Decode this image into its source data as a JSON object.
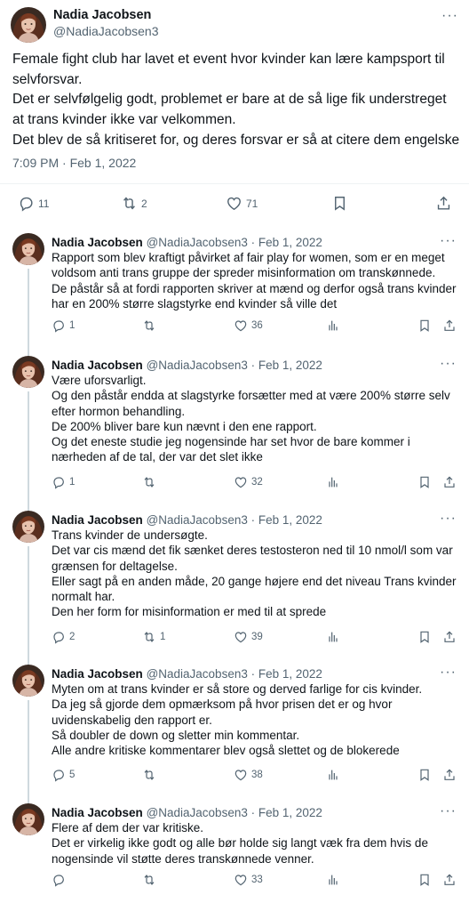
{
  "main": {
    "author_name": "Nadia Jacobsen",
    "author_handle": "@NadiaJacobsen3",
    "text": "Female fight club har lavet et event hvor kvinder kan lære kampsport til selvforsvar.\nDet er selvfølgelig godt, problemet er bare at de så lige fik understreget at trans kvinder ikke var velkommen.\nDet blev de så kritiseret for, og deres forsvar er så at citere dem engelske",
    "timestamp": "7:09 PM · Feb 1, 2022",
    "replies": "11",
    "retweets": "2",
    "likes": "71"
  },
  "replies": [
    {
      "name": "Nadia Jacobsen",
      "meta": "@NadiaJacobsen3 · Feb 1, 2022",
      "text": "Rapport som blev kraftigt påvirket af fair play for women, som er en meget voldsom anti trans gruppe der spreder misinformation om transkønnede.\nDe påstår så at fordi rapporten skriver at mænd og derfor også trans kvinder har en 200% større slagstyrke end kvinder så ville det",
      "reply_count": "1",
      "retweet_count": "",
      "like_count": "36"
    },
    {
      "name": "Nadia Jacobsen",
      "meta": "@NadiaJacobsen3 · Feb 1, 2022",
      "text": "Være uforsvarligt.\nOg den påstår endda at slagstyrke forsætter med at være 200% større selv efter hormon behandling.\nDe 200% bliver bare kun nævnt i den ene rapport.\nOg det eneste studie jeg nogensinde har set hvor de bare kommer i nærheden af de tal, der var det slet ikke",
      "reply_count": "1",
      "retweet_count": "",
      "like_count": "32"
    },
    {
      "name": "Nadia Jacobsen",
      "meta": "@NadiaJacobsen3 · Feb 1, 2022",
      "text": "Trans kvinder de undersøgte.\nDet var cis mænd det fik sænket deres testosteron ned til 10 nmol/l som var grænsen for deltagelse.\nEller sagt på en anden måde, 20 gange højere end det niveau Trans kvinder normalt har.\nDen her form for misinformation er med til at sprede",
      "reply_count": "2",
      "retweet_count": "1",
      "like_count": "39"
    },
    {
      "name": "Nadia Jacobsen",
      "meta": "@NadiaJacobsen3 · Feb 1, 2022",
      "text": "Myten om at trans kvinder er så store og derved farlige for cis kvinder.\nDa jeg så gjorde dem opmærksom på hvor prisen det er og hvor uvidenskabelig den rapport er.\nSå doubler de down og sletter min kommentar.\nAlle andre kritiske kommentarer blev også slettet og de blokerede",
      "reply_count": "5",
      "retweet_count": "",
      "like_count": "38"
    },
    {
      "name": "Nadia Jacobsen",
      "meta": "@NadiaJacobsen3 · Feb 1, 2022",
      "text": "Flere af dem der var kritiske.\nDet er virkelig ikke godt og alle bør holde sig langt væk fra dem hvis de nogensinde vil støtte deres transkønnede venner.",
      "reply_count": "",
      "retweet_count": "",
      "like_count": "33"
    }
  ],
  "icons": {
    "more": "more-icon",
    "reply": "reply-icon",
    "retweet": "retweet-icon",
    "like": "heart-icon",
    "views": "views-icon",
    "bookmark": "bookmark-icon",
    "share": "share-icon"
  },
  "colors": {
    "text": "#0f1419",
    "secondary": "#536471",
    "divider": "#eff3f4",
    "thread_line": "#cfd9de"
  }
}
